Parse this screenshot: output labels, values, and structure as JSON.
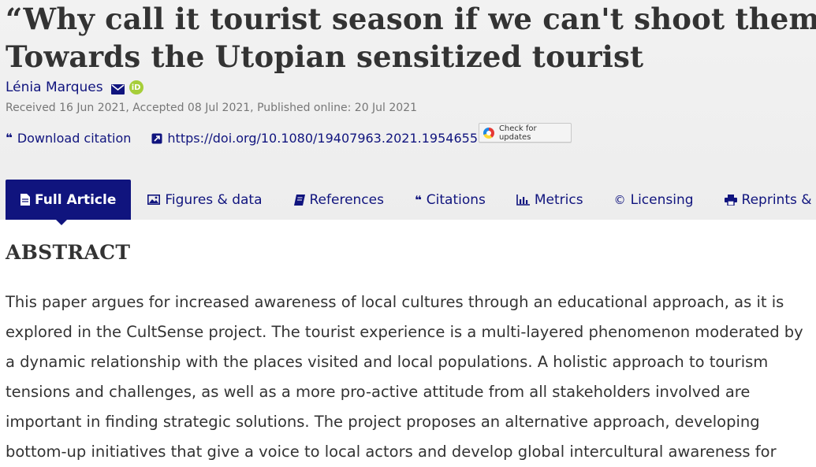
{
  "article": {
    "title_line1": "“Why call it tourist season if we can't shoot them?”",
    "title_line2": "Towards the Utopian sensitized tourist",
    "author": "Lénia Marques",
    "orcid_label": "iD",
    "dates": "Received 16 Jun 2021, Accepted 08 Jul 2021, Published online: 20 Jul 2021"
  },
  "actions": {
    "download_citation": "Download citation",
    "doi": "https://doi.org/10.1080/19407963.2021.1954655",
    "check_updates": "Check for updates"
  },
  "tabs": [
    {
      "label": "Full Article",
      "icon": "document-icon",
      "active": true
    },
    {
      "label": "Figures & data",
      "icon": "image-icon"
    },
    {
      "label": "References",
      "icon": "book-icon"
    },
    {
      "label": "Citations",
      "icon": "quote-icon"
    },
    {
      "label": "Metrics",
      "icon": "bar-chart-icon"
    },
    {
      "label": "Licensing",
      "icon": "copyright-icon"
    },
    {
      "label": "Reprints & Permi",
      "icon": "printer-icon"
    }
  ],
  "abstract": {
    "heading": "ABSTRACT",
    "lines": [
      "This paper argues for increased awareness of local cultures through an educational approach, as it is",
      "explored in the CultSense project. The tourist experience is a multi-layered phenomenon moderated by",
      "a dynamic relationship with the places visited and local populations. A holistic approach to tourism",
      "tensions and challenges, as well as a more pro-active attitude from all stakeholders involved are",
      "important in finding strategic solutions. The project proposes an alternative approach, developing",
      "bottom-up initiatives that give a voice to local actors and develop global intercultural awareness for"
    ]
  },
  "colors": {
    "accent": "#10147e",
    "header_bg": "#f0f0f0",
    "orcid": "#a6ce39"
  }
}
